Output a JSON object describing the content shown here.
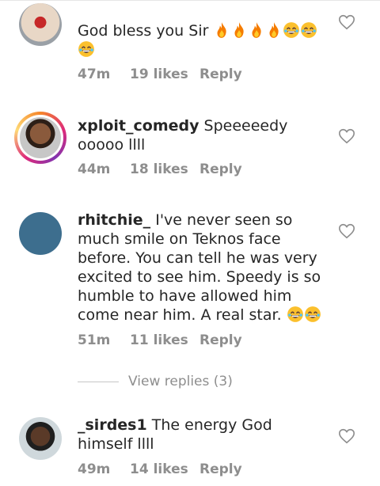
{
  "comments": [
    {
      "username": "",
      "text": "God bless you Sir",
      "emojis": [
        "fire",
        "fire",
        "fire",
        "fire",
        "grin",
        "grin",
        "grin"
      ],
      "time": "47m",
      "likes": "19 likes",
      "reply": "Reply"
    },
    {
      "username": "xploit_comedy",
      "text": " Speeeeedy ooooo llll",
      "emojis": [],
      "time": "44m",
      "likes": "18 likes",
      "reply": "Reply"
    },
    {
      "username": "rhitchie_",
      "text": " I've never seen so much smile on Teknos face before. You can tell he was very excited to see him. Speedy is so humble to have allowed him come near him. A real star. ",
      "emojis": [
        "grin",
        "grin"
      ],
      "time": "51m",
      "likes": "11 likes",
      "reply": "Reply"
    },
    {
      "username": "_sirdes1",
      "text": " The energy God himself llll",
      "emojis": [],
      "time": "49m",
      "likes": "14 likes",
      "reply": "Reply"
    }
  ],
  "view_replies": "View replies (3)",
  "icons": {
    "heart": "heart-outline-icon",
    "fire": "fire-emoji",
    "grin": "grinning-tears-emoji"
  },
  "colors": {
    "meta": "#8e8e8e",
    "text": "#262626"
  }
}
